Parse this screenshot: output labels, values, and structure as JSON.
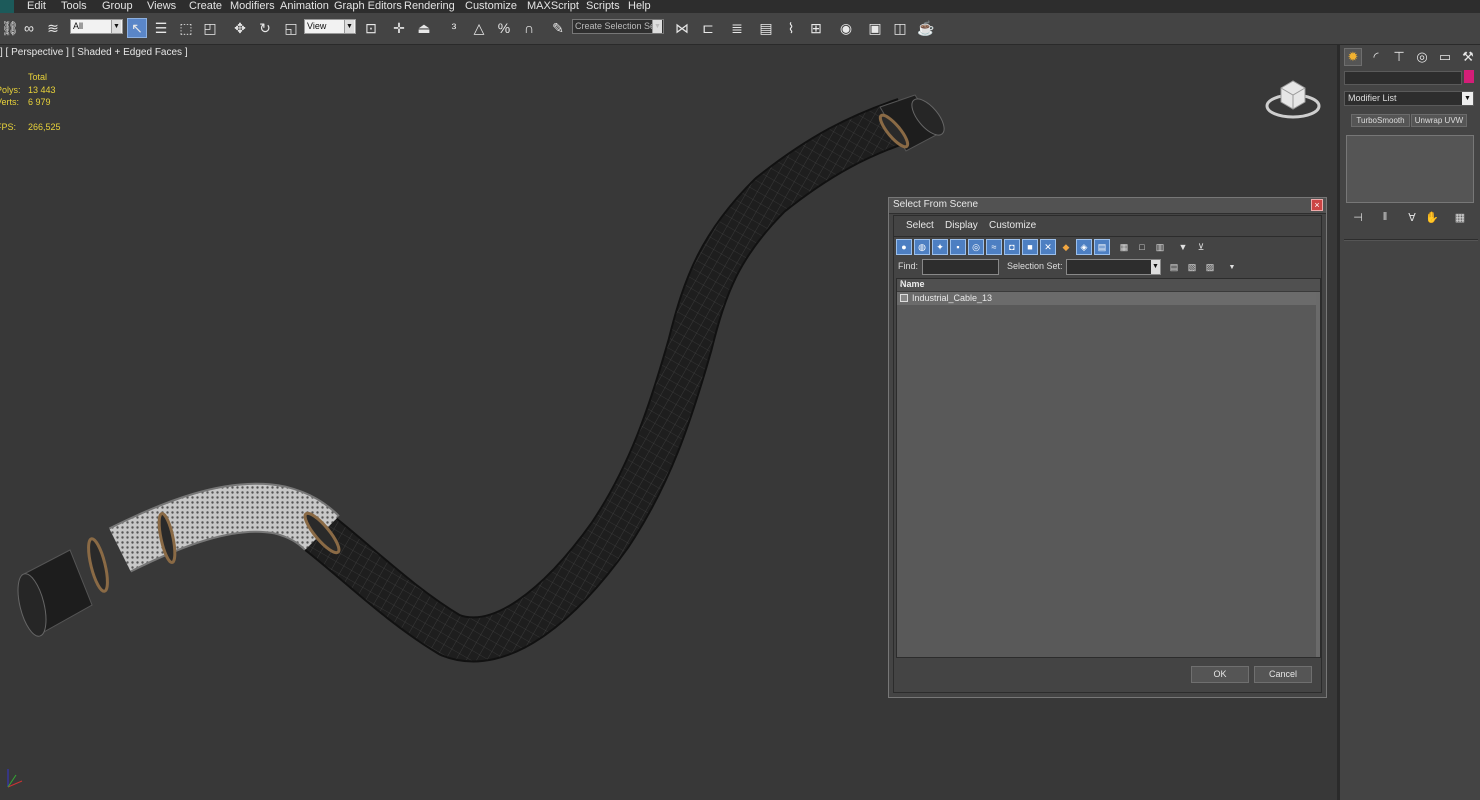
{
  "menubar": {
    "items": [
      "Edit",
      "Tools",
      "Group",
      "Views",
      "Create",
      "Modifiers",
      "Animation",
      "Graph Editors",
      "Rendering",
      "Customize",
      "MAXScript",
      "Scripts",
      "Help"
    ]
  },
  "toolbar": {
    "selection_filter": "All",
    "reference_coord": "View",
    "named_selection_placeholder": "Create Selection Se"
  },
  "viewport": {
    "label": "] [ Perspective ] [ Shaded + Edged Faces ]",
    "stats": {
      "header": "Total",
      "polys_label": "Polys:",
      "polys_value": "13 443",
      "verts_label": "Verts:",
      "verts_value": "6 979",
      "fps_label": "FPS:",
      "fps_value": "266,525"
    }
  },
  "command_panel": {
    "modifier_list": "Modifier List",
    "buttons": [
      "TurboSmooth",
      "Unwrap UVW"
    ],
    "object_color": "#d41e78"
  },
  "dialog": {
    "title": "Select From Scene",
    "menu": [
      "Select",
      "Display",
      "Customize"
    ],
    "find_label": "Find:",
    "selection_set_label": "Selection Set:",
    "list_header": "Name",
    "sort_glyph": "/",
    "items": [
      "Industrial_Cable_13"
    ],
    "ok_label": "OK",
    "cancel_label": "Cancel"
  }
}
